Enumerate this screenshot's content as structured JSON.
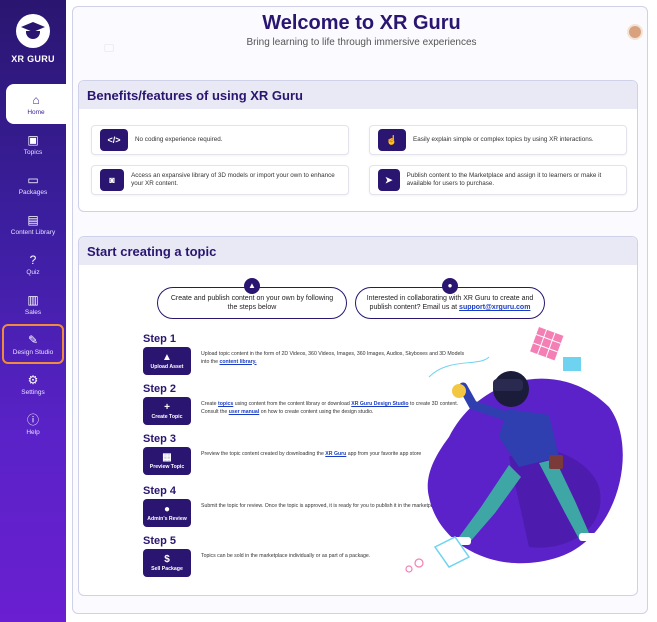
{
  "app": {
    "logo_text": "XR GURU"
  },
  "sidebar": {
    "items": [
      {
        "label": "Home",
        "icon": "home-icon"
      },
      {
        "label": "Topics",
        "icon": "topics-icon"
      },
      {
        "label": "Packages",
        "icon": "packages-icon"
      },
      {
        "label": "Content Library",
        "icon": "content-library-icon"
      },
      {
        "label": "Quiz",
        "icon": "quiz-icon"
      },
      {
        "label": "Sales",
        "icon": "sales-icon"
      },
      {
        "label": "Design Studio",
        "icon": "design-studio-icon"
      },
      {
        "label": "Settings",
        "icon": "settings-icon"
      },
      {
        "label": "Help",
        "icon": "help-icon"
      }
    ]
  },
  "header": {
    "title": "Welcome to XR Guru",
    "subtitle": "Bring learning to life through immersive experiences"
  },
  "benefits": {
    "title": "Benefits/features of using XR Guru",
    "items": [
      {
        "text": "No coding experience required.",
        "icon": "code-icon"
      },
      {
        "text": "Easily explain simple or complex topics by using XR interactions.",
        "icon": "touch-icon"
      },
      {
        "text": "Access an expansive library of 3D models or import your own to enhance your XR content.",
        "icon": "vr-headset-icon"
      },
      {
        "text": "Publish content to the Marketplace and assign it to learners or make it available for users to purchase.",
        "icon": "send-icon"
      }
    ]
  },
  "creating": {
    "title": "Start creating  a topic",
    "pill_left": "Create and publish content on your own by following the steps below",
    "pill_right_pre": "Interested in collaborating with XR Guru to create and publish content? Email us at ",
    "pill_right_link": "support@xrguru.com",
    "steps": [
      {
        "title": "Step 1",
        "button": "Upload Asset",
        "desc_pre": "Upload topic content in the form of 2D Videos, 360 Videos, Images, 360 Images, Audios, Skyboxes and 3D Models into the ",
        "desc_link": "content library.",
        "desc_post": ""
      },
      {
        "title": "Step 2",
        "button": "Create Topic",
        "desc_pre": "Create ",
        "desc_link": "topics",
        "desc_mid": " using content from the content library or download ",
        "desc_link2": "XR Guru Design Studio",
        "desc_mid2": " to create 3D content. Consult the ",
        "desc_link3": "user manual",
        "desc_post": " on how to create content using the design studio."
      },
      {
        "title": "Step 3",
        "button": "Preview Topic",
        "desc_pre": "Preview the topic content created by downloading the ",
        "desc_link": "XR Guru",
        "desc_post": " app from your favorite app store"
      },
      {
        "title": "Step 4",
        "button": "Admin's Review",
        "desc_pre": "Submit the topic for review. Once the topic is approved, it is ready for you to publish it in the marketplace.",
        "desc_link": "",
        "desc_post": ""
      },
      {
        "title": "Step 5",
        "button": "Sell Package",
        "desc_pre": "Topics can be sold in the marketplace individually or as part of a package.",
        "desc_link": "",
        "desc_post": ""
      }
    ]
  },
  "colors": {
    "brand": "#2a1670",
    "accent": "#5a22c8",
    "highlight": "#f08a3c",
    "link": "#1a3dc4"
  }
}
